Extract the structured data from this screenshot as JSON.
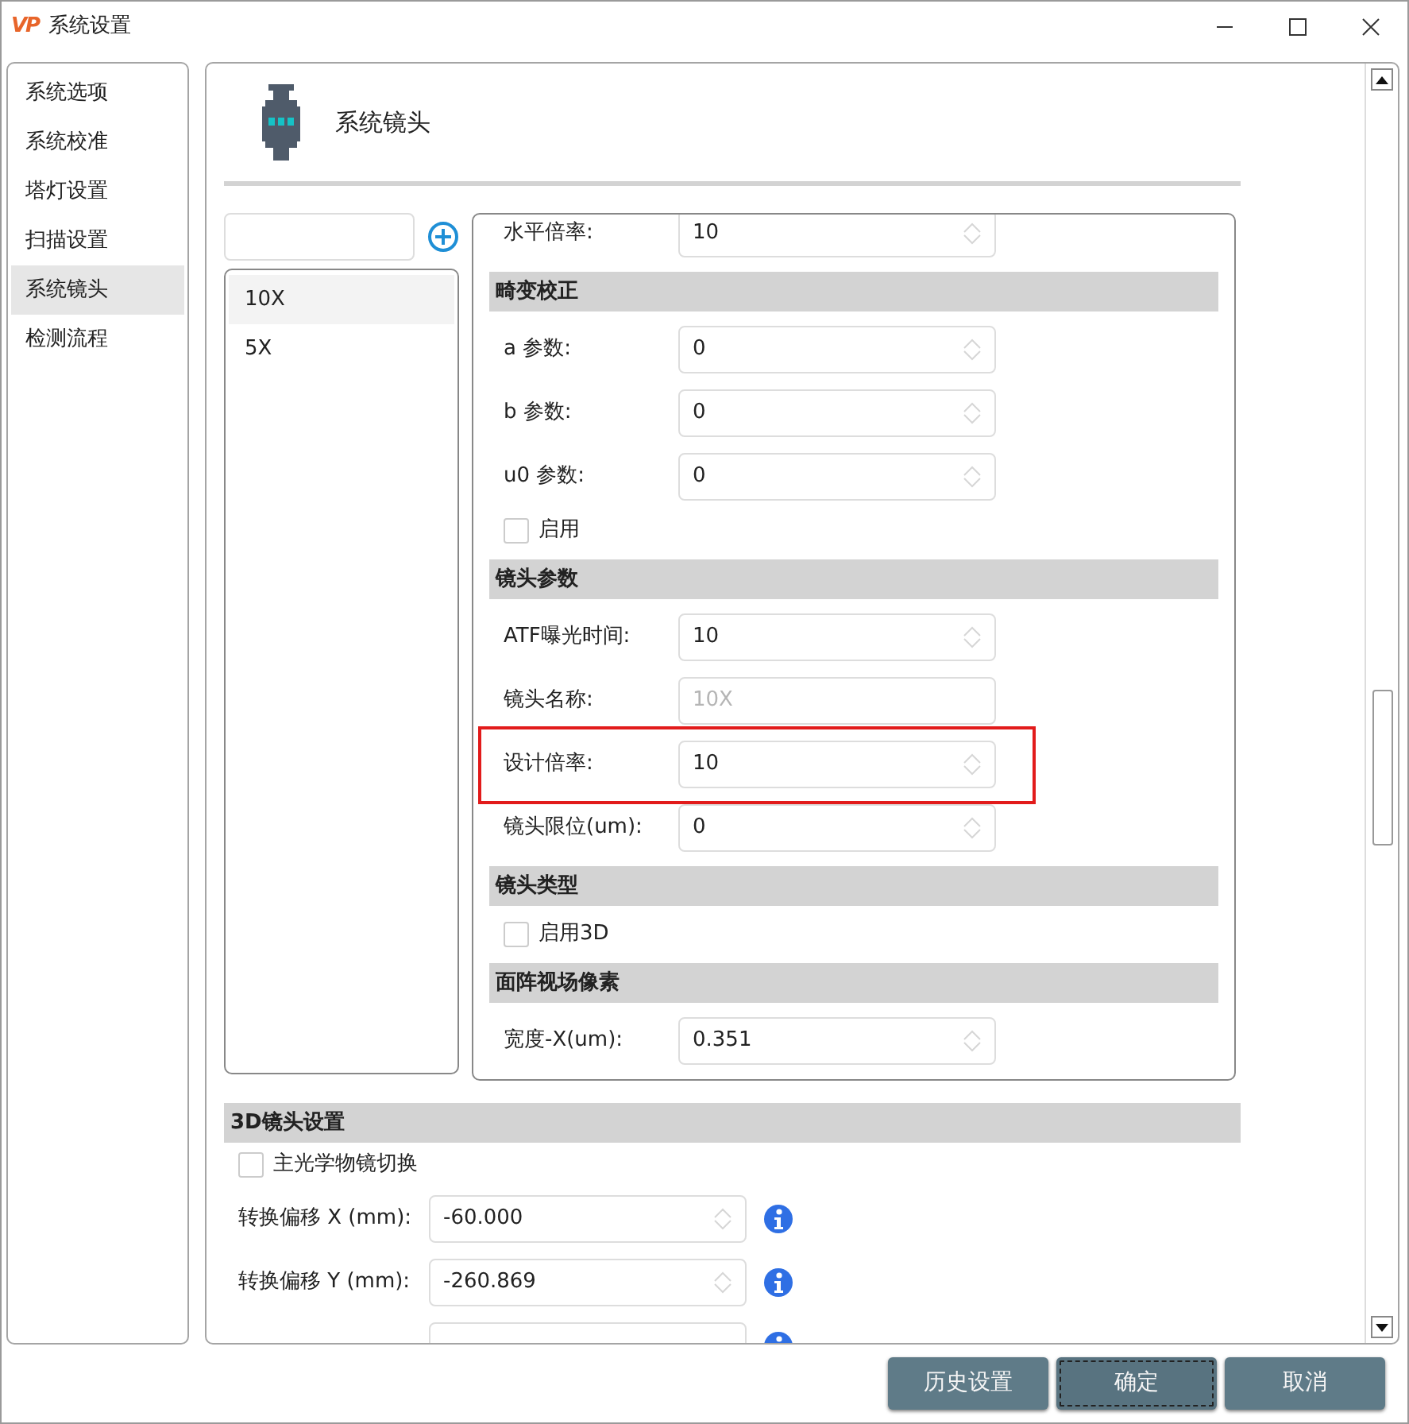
{
  "window": {
    "logo": "VP",
    "title": "系统设置"
  },
  "sidebar": {
    "items": [
      {
        "label": "系统选项",
        "selected": false
      },
      {
        "label": "系统校准",
        "selected": false
      },
      {
        "label": "塔灯设置",
        "selected": false
      },
      {
        "label": "扫描设置",
        "selected": false
      },
      {
        "label": "系统镜头",
        "selected": true
      },
      {
        "label": "检测流程",
        "selected": false
      }
    ]
  },
  "page": {
    "title": "系统镜头"
  },
  "lens_list": {
    "items": [
      {
        "label": "10X",
        "selected": true
      },
      {
        "label": "5X",
        "selected": false
      }
    ]
  },
  "form": [
    {
      "kind": "field",
      "label": "水平倍率:",
      "value": "10",
      "disabled": false,
      "highlighted": false
    },
    {
      "kind": "header",
      "label": "畸变校正"
    },
    {
      "kind": "field",
      "label": "a 参数:",
      "value": "0",
      "disabled": false,
      "highlighted": false
    },
    {
      "kind": "field",
      "label": "b 参数:",
      "value": "0",
      "disabled": false,
      "highlighted": false
    },
    {
      "kind": "field",
      "label": "u0 参数:",
      "value": "0",
      "disabled": false,
      "highlighted": false
    },
    {
      "kind": "checkbox",
      "label": "启用",
      "checked": false
    },
    {
      "kind": "header",
      "label": "镜头参数"
    },
    {
      "kind": "field",
      "label": "ATF曝光时间:",
      "value": "10",
      "disabled": false,
      "highlighted": false
    },
    {
      "kind": "field",
      "label": "镜头名称:",
      "value": "10X",
      "disabled": true,
      "highlighted": false
    },
    {
      "kind": "field",
      "label": "设计倍率:",
      "value": "10",
      "disabled": false,
      "highlighted": true
    },
    {
      "kind": "field",
      "label": "镜头限位(um):",
      "value": "0",
      "disabled": false,
      "highlighted": false
    },
    {
      "kind": "header",
      "label": "镜头类型"
    },
    {
      "kind": "checkbox",
      "label": "启用3D",
      "checked": false
    },
    {
      "kind": "header",
      "label": "面阵视场像素"
    },
    {
      "kind": "field",
      "label": "宽度-X(um):",
      "value": "0.351",
      "disabled": false,
      "highlighted": false
    }
  ],
  "settings_3d": {
    "title": "3D镜头设置",
    "items": [
      {
        "kind": "checkbox",
        "label": "主光学物镜切换",
        "checked": false
      },
      {
        "kind": "field",
        "label": "转换偏移 X (mm):",
        "value": "-60.000"
      },
      {
        "kind": "field",
        "label": "转换偏移 Y (mm):",
        "value": "-260.869"
      },
      {
        "kind": "partial"
      }
    ]
  },
  "buttons": [
    {
      "label": "历史设置",
      "focused": false
    },
    {
      "label": "确定",
      "focused": true
    },
    {
      "label": "取消",
      "focused": false
    }
  ]
}
